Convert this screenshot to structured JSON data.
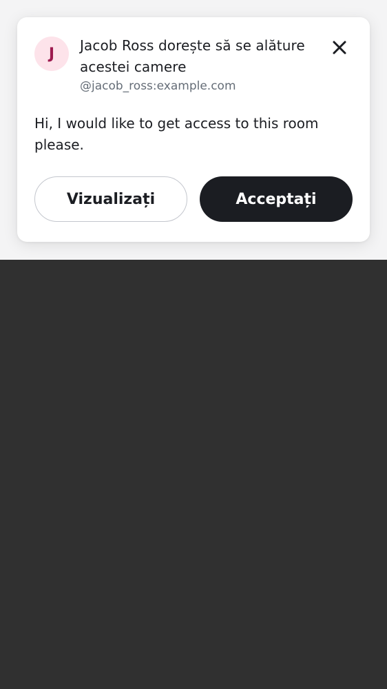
{
  "join_request": {
    "avatar_initial": "J",
    "title": "Jacob Ross dorește să se alăture acestei camere",
    "user_id": "@jacob_ross:example.com",
    "message": "Hi, I would like to get access to this room please.",
    "close_icon": "close-icon",
    "view_label": "Vizualizați",
    "accept_label": "Acceptați"
  },
  "colors": {
    "avatar_bg": "#fde3ea",
    "avatar_text": "#9d1b4f",
    "accept_bg": "#1b1d22",
    "background_top": "#f4f4f5",
    "background_bottom": "#303030"
  }
}
